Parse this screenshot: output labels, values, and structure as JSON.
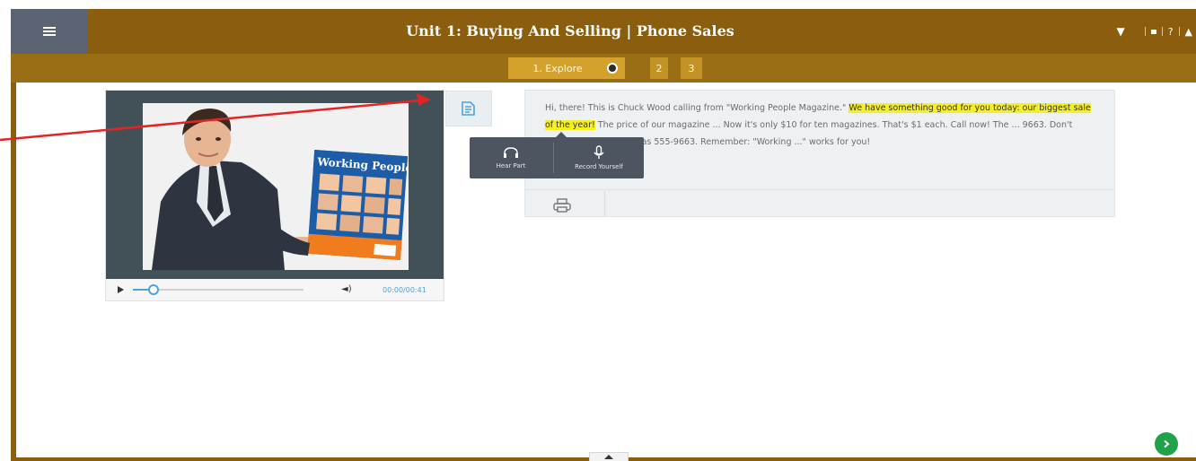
{
  "header": {
    "title": "Unit 1: Buying And Selling | Phone Sales",
    "menu_icon": "hamburger-menu-icon",
    "right_icons": [
      "chevron-down-icon",
      "screen-icon",
      "help-icon",
      "user-icon"
    ],
    "help_label": "?",
    "colors": {
      "bar": "#8a5e0e",
      "menu": "#5b6472"
    }
  },
  "tabs": [
    {
      "label": "1. Explore"
    },
    {
      "label": "2"
    },
    {
      "label": "3"
    }
  ],
  "media": {
    "image_alt": "Man holding Working People magazine",
    "magazine_title": "Working People",
    "player": {
      "time": "00:00/00:41",
      "progress": 0.12
    }
  },
  "popup": {
    "hear_label": "Hear Part",
    "record_label": "Record Yourself"
  },
  "passage": {
    "before": "Hi, there! This is Chuck Wood calling from \"Working People Magazine.\" ",
    "highlight": "We have something good for you today: our biggest sale of the year!",
    "after": " The price of our magazine ... Now it's only $10 for ten magazines. That's $1 each. Call now! The ... 9663. Don't forget! That number was 555-9663. Remember: \"Working ...\" works for you!"
  },
  "icons": {
    "module": "book-icon",
    "print": "print-icon",
    "next": "chevron-right-icon",
    "collapse": "chevron-up-icon"
  },
  "accent": "#1fa24a",
  "highlight_color": "#f6f023"
}
